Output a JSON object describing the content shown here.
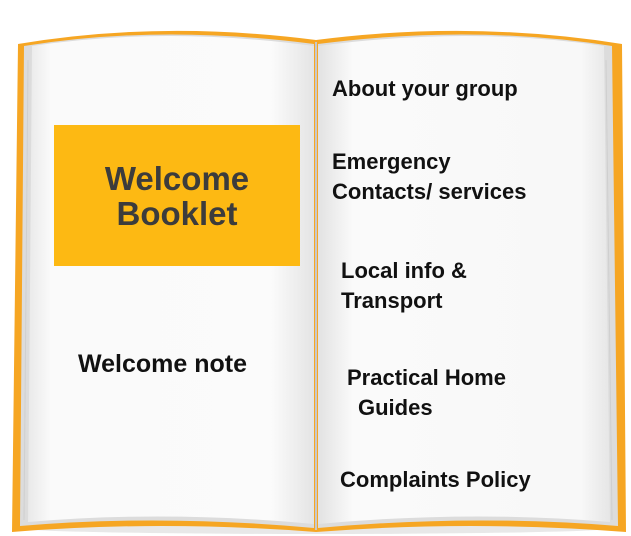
{
  "left_page": {
    "title_lines": [
      "Welcome",
      "Booklet"
    ],
    "note": "Welcome note"
  },
  "right_page": {
    "items": [
      {
        "lines": [
          "About your group"
        ]
      },
      {
        "lines": [
          "Emergency",
          "Contacts/ services"
        ]
      },
      {
        "lines": [
          "Local info &",
          "Transport"
        ]
      },
      {
        "lines": [
          "Practical Home",
          "Guides"
        ]
      },
      {
        "lines": [
          "Complaints Policy"
        ]
      }
    ]
  },
  "colors": {
    "title_box": "#fdb913",
    "cover": "#f6a623",
    "page": "#fbfbfb"
  }
}
